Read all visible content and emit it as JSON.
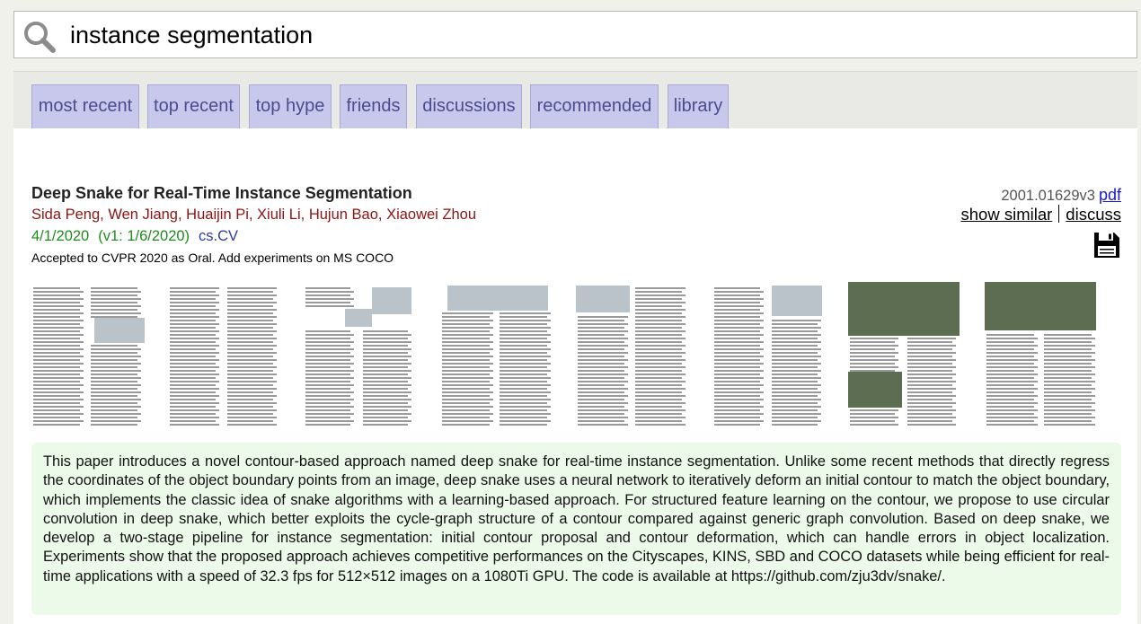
{
  "search": {
    "value": "instance segmentation"
  },
  "tabs": [
    {
      "label": "most recent"
    },
    {
      "label": "top recent"
    },
    {
      "label": "top hype"
    },
    {
      "label": "friends"
    },
    {
      "label": "discussions"
    },
    {
      "label": "recommended"
    },
    {
      "label": "library"
    }
  ],
  "paper": {
    "title": "Deep Snake for Real-Time Instance Segmentation",
    "authors": [
      "Sida Peng",
      "Wen Jiang",
      "Huaijin Pi",
      "Xiuli Li",
      "Hujun Bao",
      "Xiaowei Zhou"
    ],
    "author_separator": ", ",
    "date": "4/1/2020",
    "v1_date": "(v1: 1/6/2020)",
    "category": "cs.CV",
    "comment": "Accepted to CVPR 2020 as Oral. Add experiments on MS COCO",
    "arxiv_id": "2001.01629v3",
    "pdf_label": "pdf",
    "show_similar_label": "show similar",
    "discuss_label": "discuss",
    "save_icon": "floppy-disk-icon",
    "thumbnail_count": 8,
    "abstract": "This paper introduces a novel contour-based approach named deep snake for real-time instance segmentation. Unlike some recent methods that directly regress the coordinates of the object boundary points from an image, deep snake uses a neural network to iteratively deform an initial contour to match the object boundary, which implements the classic idea of snake algorithms with a learning-based approach. For structured feature learning on the contour, we propose to use circular convolution in deep snake, which better exploits the cycle-graph structure of a contour compared against generic graph convolution. Based on deep snake, we develop a two-stage pipeline for instance segmentation: initial contour proposal and contour deformation, which can handle errors in object localization. Experiments show that the proposed approach achieves competitive performances on the Cityscapes, KINS, SBD and COCO datasets while being efficient for real-time applications with a speed of 32.3 fps for 512×512 images on a 1080Ti GPU. The code is available at https://github.com/zju3dv/snake/."
  },
  "colors": {
    "tab_bg": "#c7c8ec",
    "tab_text": "#4a4c8e",
    "author": "#8b1313",
    "date": "#1f8a1f",
    "category": "#2f3a9c",
    "pdf_link": "#1a1acc",
    "abstract_bg": "#ecfbe9"
  }
}
